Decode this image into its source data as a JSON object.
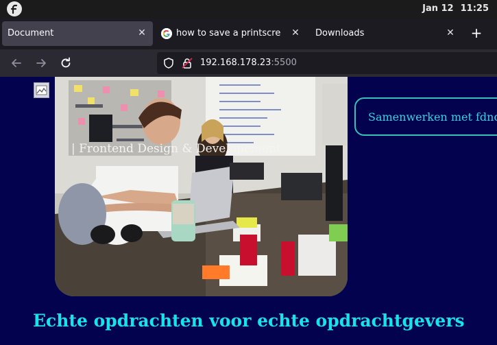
{
  "system": {
    "date": "Jan 12",
    "time": "11:25",
    "launcher_icon": "fedora-logo-icon"
  },
  "tabs": [
    {
      "label": "Document",
      "active": true
    },
    {
      "label": "how to save a printscreen li",
      "active": false,
      "favicon": "google-g-icon"
    },
    {
      "label": "Downloads",
      "active": false
    }
  ],
  "nav": {
    "back_icon": "arrow-left-icon",
    "forward_icon": "arrow-right-icon",
    "reload_icon": "reload-icon",
    "url_host": "192.168.178.23",
    "url_port": ":5500",
    "shield_icon": "shield-icon",
    "insecure_icon": "insecure-lock-icon"
  },
  "page": {
    "photo_caption": "| Frontend Design & Developement",
    "collab_button": "Samenwerken met fdnd",
    "headline": "Echte opdrachten voor echte opdrachtgevers"
  },
  "colors": {
    "page_background": "#02024f",
    "accent_teal": "#18e2ea",
    "button_border": "#36c2b8"
  }
}
